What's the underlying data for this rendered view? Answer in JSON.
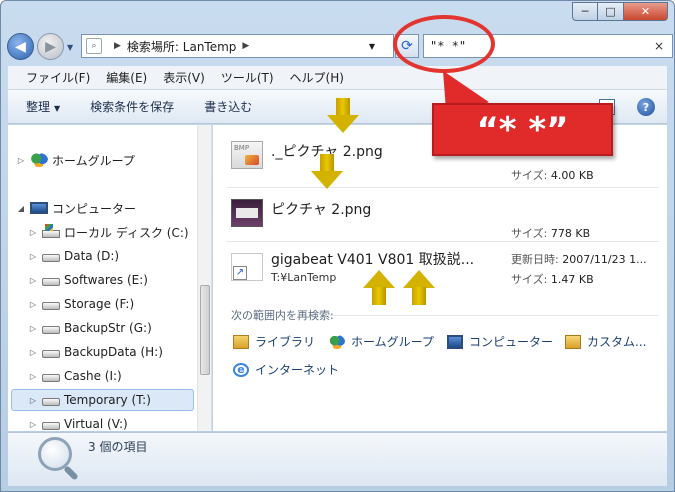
{
  "window": {
    "caption_buttons": [
      "─",
      "□",
      "✕"
    ]
  },
  "nav": {
    "back_glyph": "◀",
    "forward_glyph": "▶",
    "address_prefix": "▶",
    "address_label": "検索場所: LanTemp",
    "address_suffix": "▶",
    "refresh_glyph": "⟳",
    "search_value": "\"* *\"",
    "search_clear": "×"
  },
  "menu": {
    "items": [
      "ファイル(F)",
      "編集(E)",
      "表示(V)",
      "ツール(T)",
      "ヘルプ(H)"
    ]
  },
  "commands": {
    "organize": "整理",
    "organize_arrow": "▼",
    "save_search": "検索条件を保存",
    "burn": "書き込む",
    "help": "?"
  },
  "tree": {
    "items": [
      {
        "label": "ホームグループ",
        "expander": "▷",
        "icon": "homegroup-icon"
      },
      {
        "label": "コンピューター",
        "expander": "◢",
        "icon": "computer-icon"
      },
      {
        "label": "ローカル ディスク (C:)",
        "expander": "▷",
        "icon": "system-drive-icon"
      },
      {
        "label": "Data (D:)",
        "expander": "▷",
        "icon": "drive-icon"
      },
      {
        "label": "Softwares (E:)",
        "expander": "▷",
        "icon": "drive-icon"
      },
      {
        "label": "Storage (F:)",
        "expander": "▷",
        "icon": "drive-icon"
      },
      {
        "label": "BackupStr (G:)",
        "expander": "▷",
        "icon": "drive-icon"
      },
      {
        "label": "BackupData (H:)",
        "expander": "▷",
        "icon": "drive-icon"
      },
      {
        "label": "Cashe (I:)",
        "expander": "▷",
        "icon": "drive-icon"
      },
      {
        "label": "Temporary (T:)",
        "expander": "▷",
        "icon": "drive-icon",
        "selected": true
      },
      {
        "label": "Virtual (V:)",
        "expander": "▷",
        "icon": "drive-icon"
      }
    ]
  },
  "results": [
    {
      "name": "._ピクチャ 2.png",
      "size_label": "サイズ: ",
      "size": "4.00 KB",
      "icon": "bmp-file-icon"
    },
    {
      "name": "ピクチャ 2.png",
      "size_label": "サイズ: ",
      "size": "778 KB",
      "icon": "image-thumbnail-icon"
    },
    {
      "name": "gigabeat V401 V801 取扱説...",
      "path": "T:¥LanTemp",
      "date_label": "更新日時: ",
      "date": "2007/11/23 1...",
      "size_label": "サイズ: ",
      "size": "1.47 KB",
      "icon": "shortcut-icon"
    }
  ],
  "search_again": {
    "label": "次の範囲内を再検索:",
    "locations": [
      {
        "label": "ライブラリ",
        "icon": "library-icon"
      },
      {
        "label": "ホームグループ",
        "icon": "homegroup-icon"
      },
      {
        "label": "コンピューター",
        "icon": "computer-icon"
      },
      {
        "label": "カスタム...",
        "icon": "custom-folder-icon"
      },
      {
        "label": "インターネット",
        "icon": "internet-icon"
      }
    ]
  },
  "details": {
    "count": "3 個の項目"
  },
  "annotation": {
    "callout_text": "“* *”",
    "accent_color": "#e12a2a",
    "arrow_color": "#d4b200"
  }
}
